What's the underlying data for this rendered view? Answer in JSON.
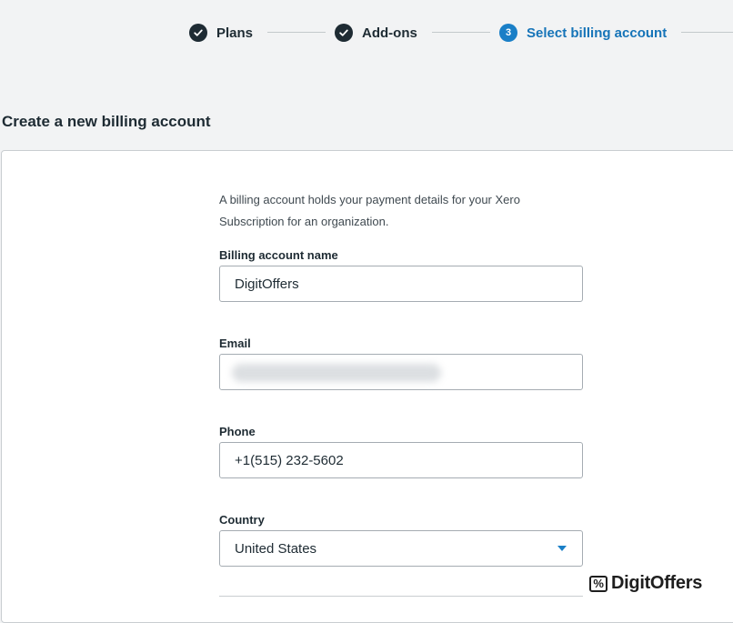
{
  "stepper": {
    "steps": [
      {
        "label": "Plans",
        "state": "done"
      },
      {
        "label": "Add-ons",
        "state": "done"
      },
      {
        "number": "3",
        "label": "Select billing account",
        "state": "current"
      }
    ]
  },
  "section": {
    "title": "Create a new billing account"
  },
  "form": {
    "intro": "A billing account holds your payment details for your Xero Subscription for an organization.",
    "name_label": "Billing account name",
    "name_value": "DigitOffers",
    "email_label": "Email",
    "email_value": "",
    "phone_label": "Phone",
    "phone_value": "+1(515) 232-5602",
    "country_label": "Country",
    "country_value": "United States"
  },
  "watermark": {
    "icon": "percent-icon",
    "text": "DigitOffers"
  },
  "colors": {
    "accent": "#1a7fc7",
    "text": "#1e2b33",
    "page_bg": "#f2f3f4"
  }
}
